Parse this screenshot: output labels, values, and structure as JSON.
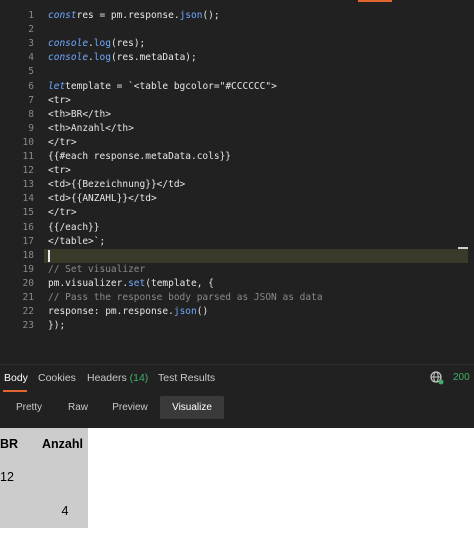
{
  "editor": {
    "lines": [
      {
        "n": "1",
        "t": [
          [
            "kw",
            "const"
          ],
          [
            "",
            "res = pm.response."
          ],
          [
            "fn",
            "json"
          ],
          [
            "",
            "();"
          ]
        ]
      },
      {
        "n": "2",
        "t": []
      },
      {
        "n": "3",
        "t": [
          [
            "kw",
            "console"
          ],
          [
            "",
            "."
          ],
          [
            "fn",
            "log"
          ],
          [
            "",
            "(res);"
          ]
        ]
      },
      {
        "n": "4",
        "t": [
          [
            "kw",
            "console"
          ],
          [
            "",
            "."
          ],
          [
            "fn",
            "log"
          ],
          [
            "",
            "(res.metaData);"
          ]
        ]
      },
      {
        "n": "5",
        "t": []
      },
      {
        "n": "6",
        "t": [
          [
            "kw",
            "let"
          ],
          [
            "",
            "template = `<table bgcolor=\"#CCCCCC\">"
          ]
        ]
      },
      {
        "n": "7",
        "t": [
          [
            "",
            "<tr>"
          ]
        ]
      },
      {
        "n": "8",
        "t": [
          [
            "",
            "<th>BR</th>"
          ]
        ]
      },
      {
        "n": "9",
        "t": [
          [
            "",
            "<th>Anzahl</th>"
          ]
        ]
      },
      {
        "n": "10",
        "t": [
          [
            "",
            "</tr>"
          ]
        ]
      },
      {
        "n": "11",
        "t": [
          [
            "",
            "{{#each response.metaData.cols}}"
          ]
        ]
      },
      {
        "n": "12",
        "t": [
          [
            "",
            "<tr>"
          ]
        ]
      },
      {
        "n": "13",
        "t": [
          [
            "",
            "<td>{{Bezeichnung}}</td>"
          ]
        ]
      },
      {
        "n": "14",
        "t": [
          [
            "",
            "<td>{{ANZAHL}}</td>"
          ]
        ]
      },
      {
        "n": "15",
        "t": [
          [
            "",
            "</tr>"
          ]
        ]
      },
      {
        "n": "16",
        "t": [
          [
            "",
            "{{/each}}"
          ]
        ]
      },
      {
        "n": "17",
        "t": [
          [
            "",
            "</table>`;"
          ]
        ]
      },
      {
        "n": "18",
        "t": []
      },
      {
        "n": "19",
        "t": [
          [
            "cm",
            "// Set visualizer"
          ]
        ]
      },
      {
        "n": "20",
        "t": [
          [
            "",
            "pm.visualizer."
          ],
          [
            "fn",
            "set"
          ],
          [
            "",
            "(template, {"
          ]
        ]
      },
      {
        "n": "21",
        "t": [
          [
            "cm",
            "// Pass the response body parsed as JSON as data"
          ]
        ]
      },
      {
        "n": "22",
        "t": [
          [
            "",
            "response: pm.response."
          ],
          [
            "fn",
            "json"
          ],
          [
            "",
            "()"
          ]
        ]
      },
      {
        "n": "23",
        "t": [
          [
            "",
            "});"
          ]
        ]
      }
    ]
  },
  "response_tabs": {
    "body": "Body",
    "cookies": "Cookies",
    "headers": "Headers",
    "headers_count": "(14)",
    "test_results": "Test Results",
    "status_code": "200"
  },
  "view_tabs": {
    "pretty": "Pretty",
    "raw": "Raw",
    "preview": "Preview",
    "visualize": "Visualize"
  },
  "visualizer": {
    "headers": [
      "BR",
      "Anzahl"
    ],
    "rows": [
      [
        "12",
        ""
      ],
      [
        "",
        "4"
      ]
    ],
    "bgcolor": "#CCCCCC"
  },
  "colors": {
    "accent": "#e0662d",
    "status_ok": "#3fae6a",
    "keyword": "#6fa8ff"
  }
}
